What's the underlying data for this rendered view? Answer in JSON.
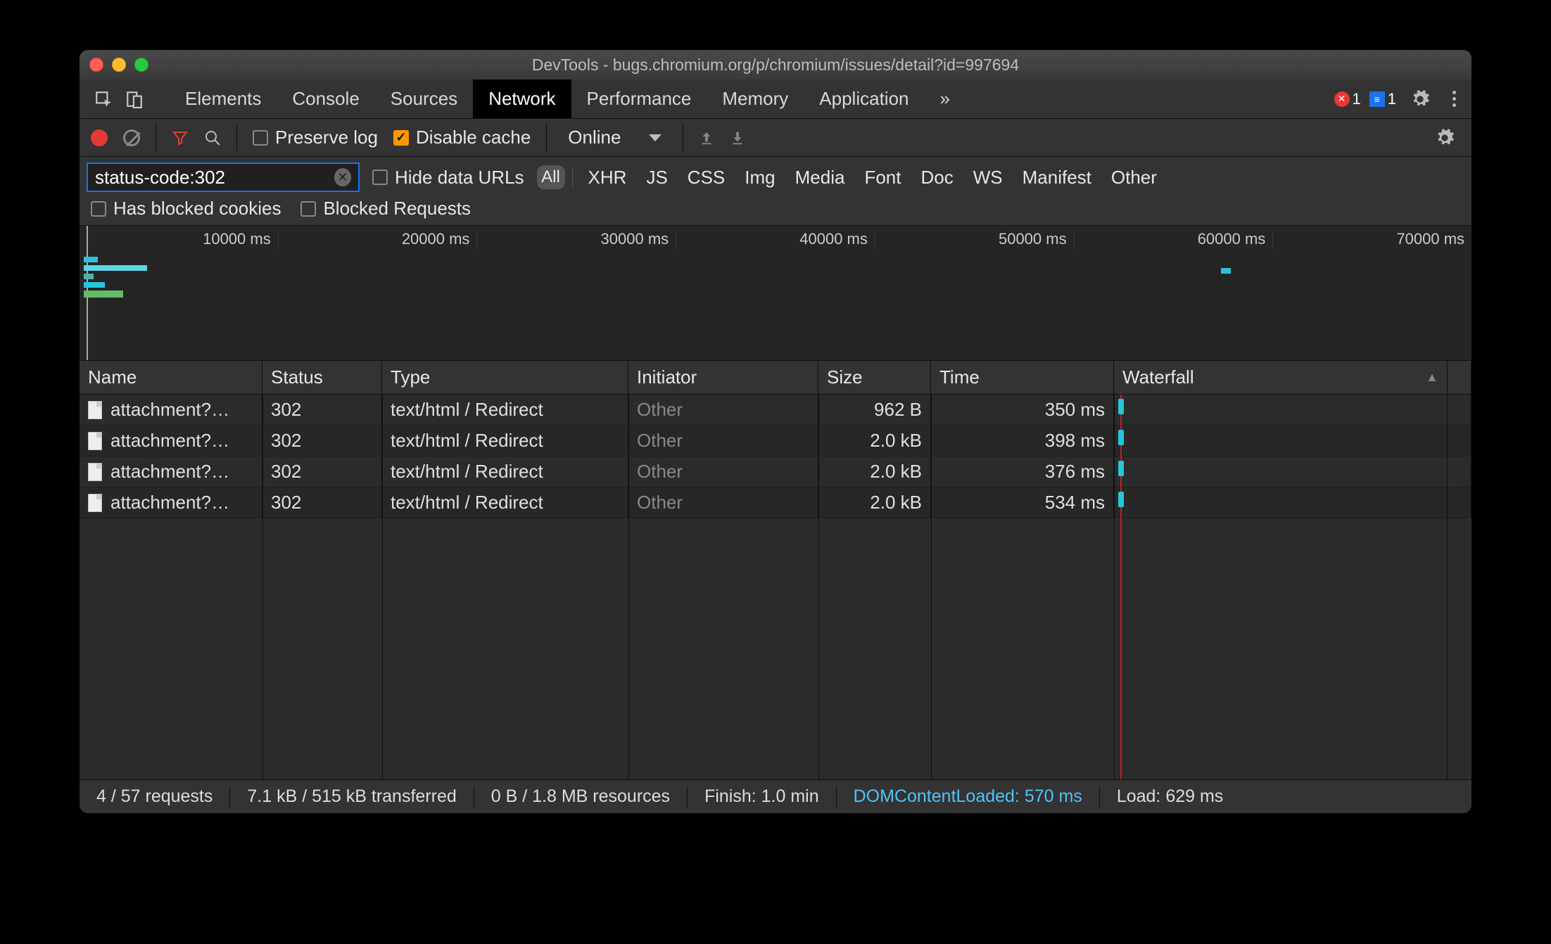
{
  "window_title": "DevTools - bugs.chromium.org/p/chromium/issues/detail?id=997694",
  "tabs": {
    "items": [
      "Elements",
      "Console",
      "Sources",
      "Network",
      "Performance",
      "Memory",
      "Application"
    ],
    "active": "Network",
    "overflow_glyph": "»",
    "error_count": "1",
    "message_count": "1"
  },
  "toolbar": {
    "preserve_log_label": "Preserve log",
    "preserve_log_checked": false,
    "disable_cache_label": "Disable cache",
    "disable_cache_checked": true,
    "throttling": "Online"
  },
  "filter": {
    "value": "status-code:302",
    "hide_data_urls_label": "Hide data URLs",
    "types": [
      "All",
      "XHR",
      "JS",
      "CSS",
      "Img",
      "Media",
      "Font",
      "Doc",
      "WS",
      "Manifest",
      "Other"
    ],
    "active_type": "All",
    "has_blocked_cookies_label": "Has blocked cookies",
    "blocked_requests_label": "Blocked Requests"
  },
  "overview": {
    "ticks": [
      "10000 ms",
      "20000 ms",
      "30000 ms",
      "40000 ms",
      "50000 ms",
      "60000 ms",
      "70000 ms"
    ]
  },
  "columns": {
    "name": "Name",
    "status": "Status",
    "type": "Type",
    "initiator": "Initiator",
    "size": "Size",
    "time": "Time",
    "waterfall": "Waterfall"
  },
  "rows": [
    {
      "name": "attachment?…",
      "status": "302",
      "type": "text/html / Redirect",
      "initiator": "Other",
      "size": "962 B",
      "time": "350 ms"
    },
    {
      "name": "attachment?…",
      "status": "302",
      "type": "text/html / Redirect",
      "initiator": "Other",
      "size": "2.0 kB",
      "time": "398 ms"
    },
    {
      "name": "attachment?…",
      "status": "302",
      "type": "text/html / Redirect",
      "initiator": "Other",
      "size": "2.0 kB",
      "time": "376 ms"
    },
    {
      "name": "attachment?…",
      "status": "302",
      "type": "text/html / Redirect",
      "initiator": "Other",
      "size": "2.0 kB",
      "time": "534 ms"
    }
  ],
  "statusbar": {
    "requests": "4 / 57 requests",
    "transferred": "7.1 kB / 515 kB transferred",
    "resources": "0 B / 1.8 MB resources",
    "finish": "Finish: 1.0 min",
    "dcl": "DOMContentLoaded: 570 ms",
    "load": "Load: 629 ms"
  }
}
